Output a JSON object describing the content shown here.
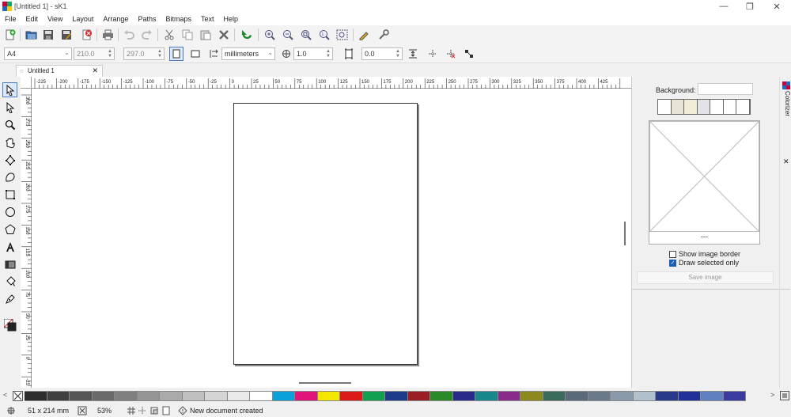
{
  "window": {
    "title": "[Untitled 1] - sK1",
    "minimize": "—",
    "maximize": "❐",
    "close": "✕"
  },
  "menu": [
    "File",
    "Edit",
    "View",
    "Layout",
    "Arrange",
    "Paths",
    "Bitmaps",
    "Text",
    "Help"
  ],
  "toolbar": {
    "icons": [
      "new-icon",
      "open-icon",
      "save-icon",
      "save-as-icon",
      "close-document-icon",
      "print-icon",
      "undo-icon",
      "redo-icon",
      "cut-icon",
      "copy-icon",
      "paste-icon",
      "delete-icon",
      "refresh-icon",
      "zoom-in-icon",
      "zoom-out-icon",
      "zoom-fit-icon",
      "zoom-page-icon",
      "zoom-selection-icon",
      "color-picker-icon",
      "preferences-icon"
    ]
  },
  "propbar": {
    "page_format": "A4",
    "width": "210.0",
    "times": "×",
    "height": "297.0",
    "units": "millimeters",
    "jump": "1.0",
    "angle": "0.0"
  },
  "tab": {
    "label": "Untitled 1",
    "close": "✕"
  },
  "ruler": {
    "h_labels": [
      "-225",
      "-200",
      "-175",
      "-150",
      "-125",
      "-100",
      "-75",
      "-50",
      "-25",
      "0",
      "25",
      "50",
      "75",
      "100",
      "125",
      "150",
      "175",
      "200",
      "225",
      "250",
      "275",
      "300",
      "325",
      "350",
      "375",
      "400",
      "425"
    ],
    "v_labels": [
      "300",
      "275",
      "250",
      "225",
      "200",
      "175",
      "150",
      "125",
      "100",
      "75",
      "50",
      "25",
      "0",
      "-25"
    ]
  },
  "side": {
    "vertical_tab": "Colorizer",
    "background_label": "Background:",
    "bg_swatches": [
      "#ffffff",
      "#e8e4d8",
      "#f0ecd8",
      "#e2e2e8",
      "#ffffff",
      "#ffffff",
      "#ffffff"
    ],
    "preview_caption": "---",
    "show_border_label": "Show image border",
    "show_border_checked": false,
    "draw_selected_label": "Draw selected only",
    "draw_selected_checked": true,
    "save_label": "Save image"
  },
  "palette": [
    "#2d2d2d",
    "#404040",
    "#555555",
    "#6a6a6a",
    "#808080",
    "#959595",
    "#aaaaaa",
    "#c0c0c0",
    "#d5d5d5",
    "#eaeaea",
    "#ffffff",
    "#0aa0d8",
    "#e0147a",
    "#f5e600",
    "#dd1a1a",
    "#12a050",
    "#1f3a8a",
    "#9a1f24",
    "#2a8a2a",
    "#2a2a8a",
    "#17878a",
    "#8a2a8a",
    "#8a8a1f",
    "#3a6a5a",
    "#5a6a7a",
    "#6a7a8a",
    "#8a9aaa",
    "#b0c0cc",
    "#2a3a8a",
    "#24309a",
    "#6080c0",
    "#3a3aa0"
  ],
  "status": {
    "coords": "51 x 214 mm",
    "zoom": "53%",
    "message": "New document created"
  }
}
